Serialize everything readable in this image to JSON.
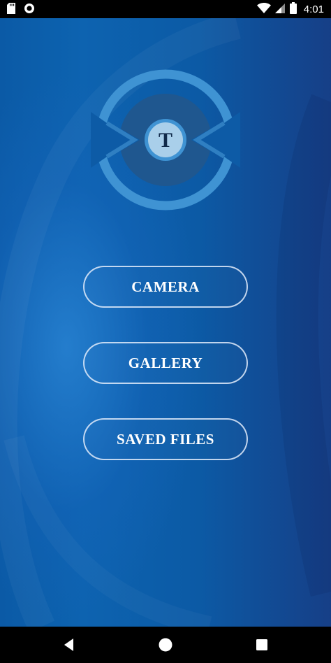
{
  "status_bar": {
    "time": "4:01",
    "icons": [
      "sd-card-icon",
      "sync-icon",
      "wifi-icon",
      "cell-signal-icon",
      "battery-icon"
    ]
  },
  "logo": {
    "letter": "T"
  },
  "buttons": {
    "camera": "CAMERA",
    "gallery": "GALLERY",
    "saved_files": "SAVED FILES"
  },
  "nav_bar": {
    "icons": [
      "back-icon",
      "home-icon",
      "recents-icon"
    ]
  },
  "colors": {
    "background_primary": "#0c5aa5",
    "background_dark": "#163f87",
    "logo_ring": "#3f93d3",
    "logo_core": "#1f578f",
    "logo_center": "#a9cfea",
    "button_border": "#e1ebfa"
  }
}
